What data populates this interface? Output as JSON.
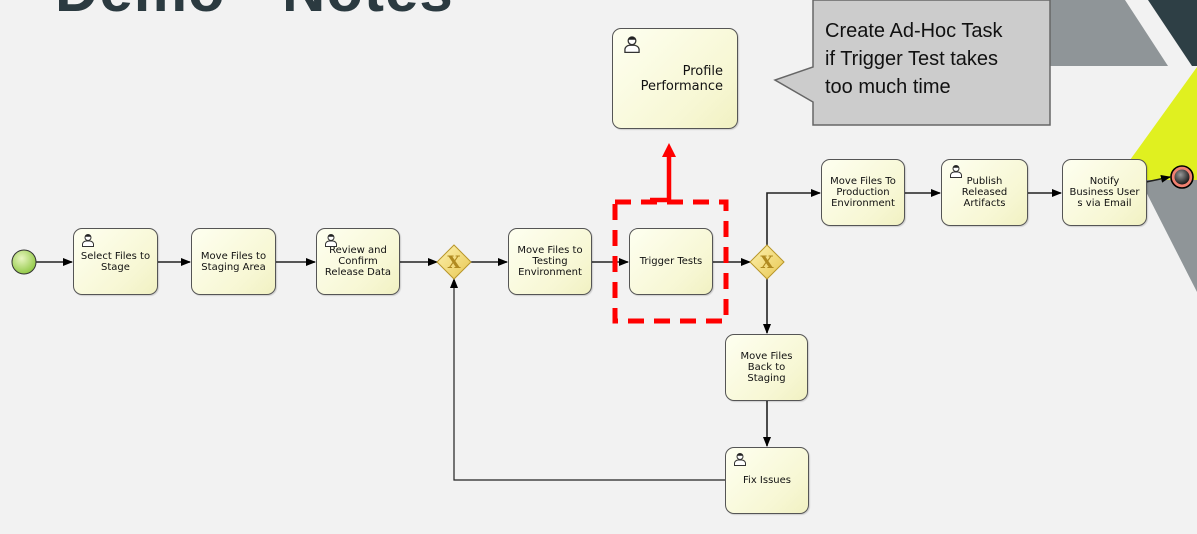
{
  "slide": {
    "title": "Demo - Notes"
  },
  "callout": {
    "text": "Create Ad-Hoc Task\nif Trigger Test takes\ntoo much time"
  },
  "process": {
    "start_event": "start-event",
    "end_event": "end-event",
    "tasks": {
      "select_files": {
        "label": "Select Files to\nStage",
        "type": "user"
      },
      "move_staging": {
        "label": "Move Files to\nStaging Area",
        "type": "service"
      },
      "review_confirm": {
        "label": "Review and\nConfirm\nRelease Data",
        "type": "user"
      },
      "move_testing": {
        "label": "Move Files to\nTesting\nEnvironment",
        "type": "service"
      },
      "trigger_tests": {
        "label": "Trigger Tests",
        "type": "service"
      },
      "profile_performance": {
        "label": "Profile\nPerformance",
        "type": "user",
        "ad_hoc": true
      },
      "move_production": {
        "label": "Move Files To\nProduction\nEnvironment",
        "type": "service"
      },
      "publish_artifacts": {
        "label": "Publish\nReleased\nArtifacts",
        "type": "user"
      },
      "notify_users": {
        "label": "Notify\nBusiness User\ns via Email",
        "type": "service"
      },
      "move_back_staging": {
        "label": "Move Files\nBack to Staging",
        "type": "service"
      },
      "fix_issues": {
        "label": "Fix Issues",
        "type": "user"
      }
    },
    "gateways": [
      "exclusive-gateway-1",
      "exclusive-gateway-2"
    ],
    "highlight": {
      "target": "trigger_tests",
      "color": "#ff0000"
    }
  },
  "colors": {
    "background": "#f2f2f2",
    "task_fill": "#f7f7d4",
    "gateway_fill": "#f5dc7a",
    "start_fill": "#9acd32",
    "end_ring": "#f08070",
    "callout_fill": "#cccccc",
    "accent_yellow": "#e0f020",
    "slate": "#2e3f45",
    "gray_shape": "#8f9598",
    "highlight": "#ff0000"
  }
}
